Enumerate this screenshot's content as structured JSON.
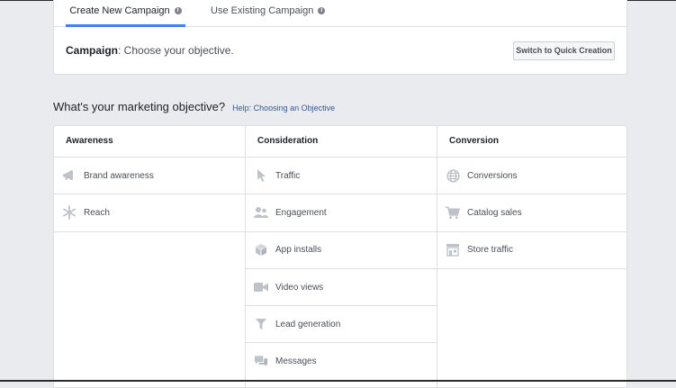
{
  "tabs": [
    {
      "label": "Create New Campaign",
      "active": true
    },
    {
      "label": "Use Existing Campaign",
      "active": false
    }
  ],
  "campaign": {
    "prefix": "Campaign",
    "text": ": Choose your objective."
  },
  "quick_button": "Switch to Quick Creation",
  "objective": {
    "heading": "What's your marketing objective?",
    "help_link": "Help: Choosing an Objective"
  },
  "columns": [
    {
      "title": "Awareness",
      "items": [
        {
          "label": "Brand awareness",
          "icon": "megaphone-icon"
        },
        {
          "label": "Reach",
          "icon": "snowflake-icon"
        }
      ]
    },
    {
      "title": "Consideration",
      "items": [
        {
          "label": "Traffic",
          "icon": "cursor-icon"
        },
        {
          "label": "Engagement",
          "icon": "people-icon"
        },
        {
          "label": "App installs",
          "icon": "box-icon"
        },
        {
          "label": "Video views",
          "icon": "video-camera-icon"
        },
        {
          "label": "Lead generation",
          "icon": "funnel-icon"
        },
        {
          "label": "Messages",
          "icon": "chat-bubbles-icon"
        }
      ]
    },
    {
      "title": "Conversion",
      "items": [
        {
          "label": "Conversions",
          "icon": "globe-icon"
        },
        {
          "label": "Catalog sales",
          "icon": "shopping-cart-icon"
        },
        {
          "label": "Store traffic",
          "icon": "store-icon"
        }
      ]
    }
  ],
  "colors": {
    "accent": "#4080ff",
    "icon": "#bec3c9",
    "link": "#365899"
  }
}
